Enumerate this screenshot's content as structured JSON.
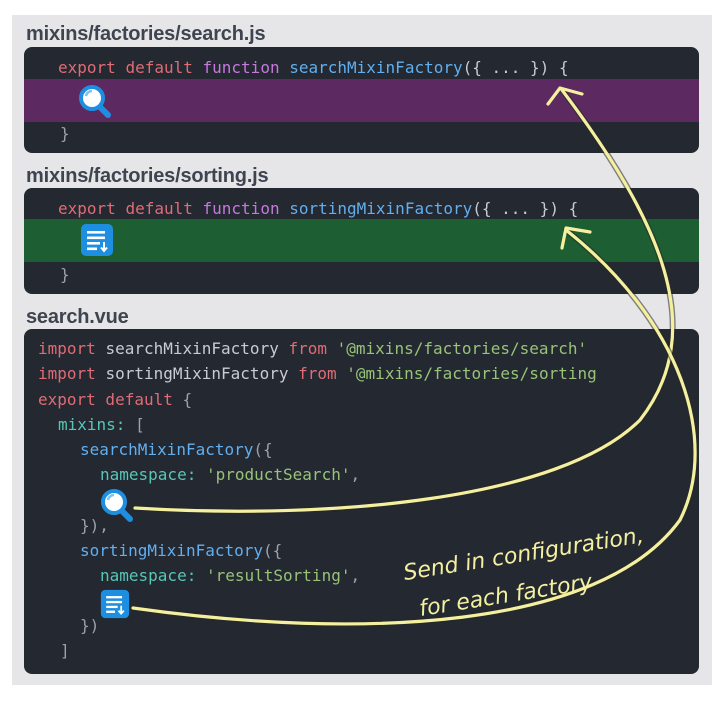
{
  "titles": {
    "search_file": "mixins/factories/search.js",
    "sorting_file": "mixins/factories/sorting.js",
    "vue_file": "search.vue"
  },
  "search_js": {
    "kw_export": "export",
    "kw_default": "default",
    "kw_function": "function",
    "fn_name": "searchMixinFactory",
    "args": "({ ... }) {",
    "close": "}"
  },
  "sorting_js": {
    "kw_export": "export",
    "kw_default": "default",
    "kw_function": "function",
    "fn_name": "sortingMixinFactory",
    "args": "({ ... }) {",
    "close": "}"
  },
  "vue": {
    "line1": {
      "kw": "import",
      "name": "searchMixinFactory",
      "from": "from",
      "path": "'@mixins/factories/search'"
    },
    "line2": {
      "kw": "import",
      "name": "sortingMixinFactory",
      "from": "from",
      "path": "'@mixins/factories/sorting"
    },
    "line3": {
      "kw": "export default",
      "brace": "{"
    },
    "line4": {
      "prop": "mixins:",
      "bracket": "["
    },
    "line5": {
      "call": "searchMixinFactory",
      "paren": "({"
    },
    "line6": {
      "prop": "namespace:",
      "str": "'productSearch'",
      "comma": ","
    },
    "line8": {
      "close": "}),"
    },
    "line9": {
      "call": "sortingMixinFactory",
      "paren": "({"
    },
    "line10": {
      "prop": "namespace:",
      "str": "'resultSorting'",
      "comma": ","
    },
    "line12": {
      "close": "})"
    },
    "line13": {
      "close": "]"
    }
  },
  "annotation": {
    "line1": "Send in configuration,",
    "line2": "for each factory"
  },
  "colors": {
    "search_highlight": "#5c2a60",
    "sorting_highlight": "#1e5e33",
    "arrow": "#f4f0a0",
    "icon_blue": "#1e8fe0"
  },
  "icons": [
    "magnifier-icon",
    "list-icon"
  ]
}
